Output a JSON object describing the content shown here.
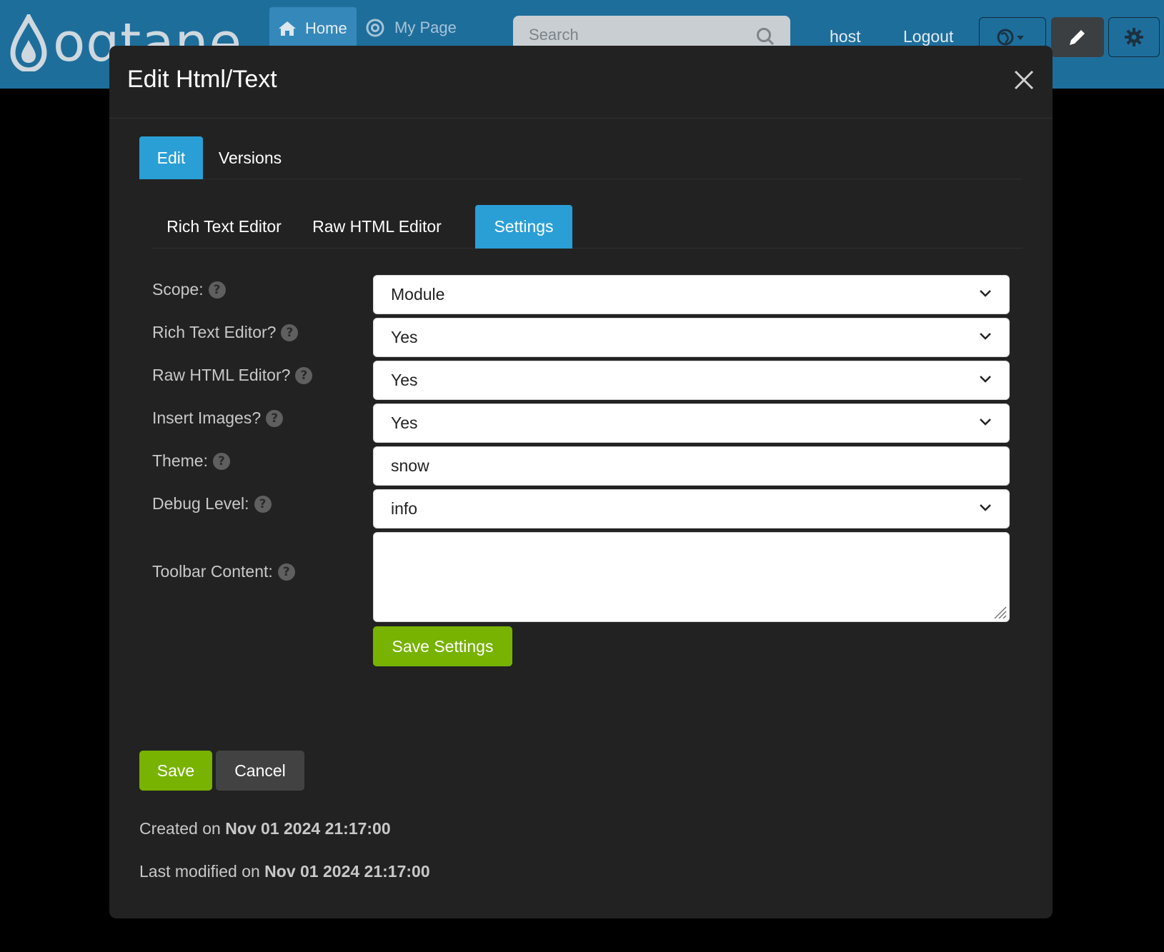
{
  "navbar": {
    "logo_text": "oqtane",
    "home_label": "Home",
    "mypage_label": "My Page",
    "search_placeholder": "Search",
    "user_label": "host",
    "logout_label": "Logout"
  },
  "modal": {
    "title": "Edit Html/Text",
    "tabs": [
      {
        "label": "Edit",
        "active": true
      },
      {
        "label": "Versions",
        "active": false
      }
    ],
    "subtabs": [
      {
        "label": "Rich Text Editor",
        "active": false
      },
      {
        "label": "Raw HTML Editor",
        "active": false
      },
      {
        "label": "Settings",
        "active": true
      }
    ],
    "settings": {
      "scope": {
        "label": "Scope:",
        "value": "Module"
      },
      "rich_text_editor": {
        "label": "Rich Text Editor?",
        "value": "Yes"
      },
      "raw_html_editor": {
        "label": "Raw HTML Editor?",
        "value": "Yes"
      },
      "insert_images": {
        "label": "Insert Images?",
        "value": "Yes"
      },
      "theme": {
        "label": "Theme:",
        "value": "snow"
      },
      "debug_level": {
        "label": "Debug Level:",
        "value": "info"
      },
      "toolbar_content": {
        "label": "Toolbar Content:",
        "value": ""
      },
      "save_settings_label": "Save Settings"
    },
    "save_label": "Save",
    "cancel_label": "Cancel",
    "created_prefix": "Created on",
    "created_date": "Nov 01 2024 21:17:00",
    "modified_prefix": "Last modified on",
    "modified_date": "Nov 01 2024 21:17:00"
  },
  "colors": {
    "navbar": "#1e6e9c",
    "modal_bg": "#222222",
    "accent": "#2a9fd6",
    "success": "#77b300"
  }
}
